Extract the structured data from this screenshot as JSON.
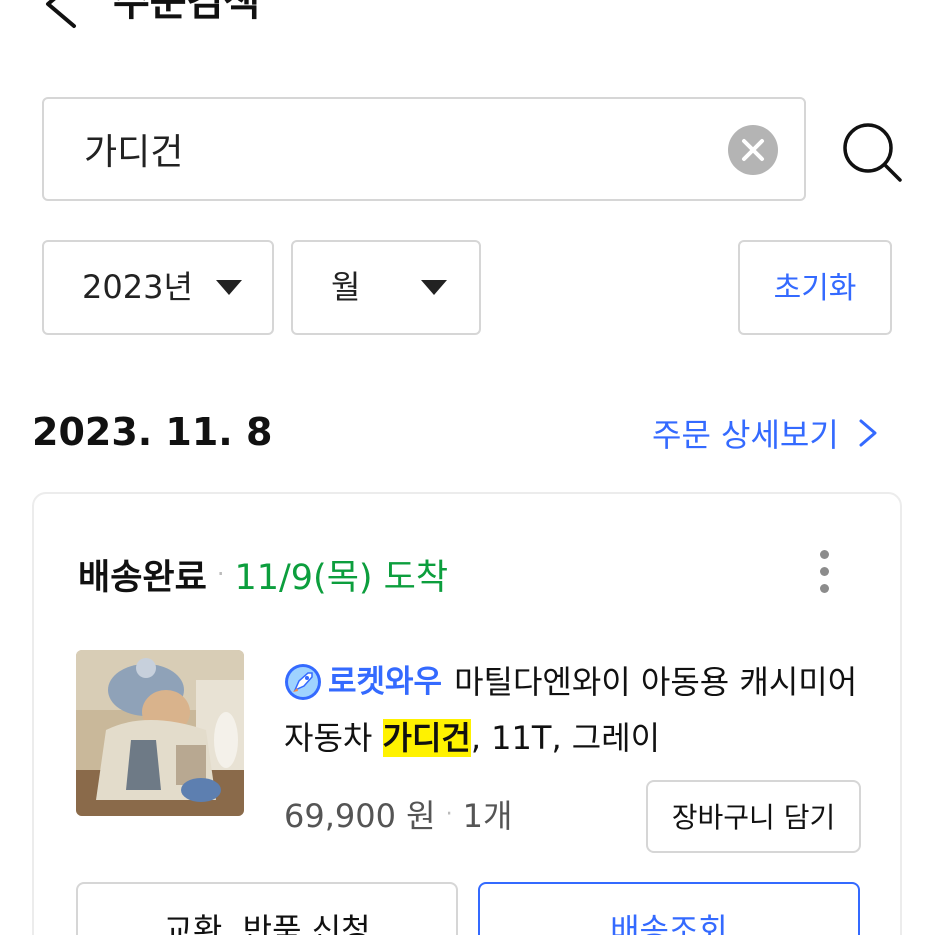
{
  "header": {
    "title": "주문검색",
    "back_icon": "chevron-left-icon"
  },
  "search": {
    "value": "가디건",
    "clear_icon": "close-circle-icon",
    "search_icon": "search-icon"
  },
  "filters": {
    "year_label": "2023년",
    "month_label": "월",
    "reset_label": "초기화"
  },
  "order": {
    "date": "2023. 11. 8",
    "detail_link": "주문 상세보기",
    "status": "배송완료",
    "arrival": "11/9(목) 도착",
    "product": {
      "badge": "로켓와우",
      "name_before": "마틸다엔와이 아동용 캐시미어 자동차 ",
      "name_highlight": "가디건",
      "name_after": ", 11T, 그레이",
      "price": "69,900 원",
      "quantity": "1개"
    },
    "cart_button": "장바구니 담기",
    "exchange_button": "교환, 반품 신청",
    "track_button": "배송조회"
  },
  "colors": {
    "accent_blue": "#346aff",
    "delivered_green": "#0c9e3d",
    "highlight_yellow": "#fff200"
  }
}
